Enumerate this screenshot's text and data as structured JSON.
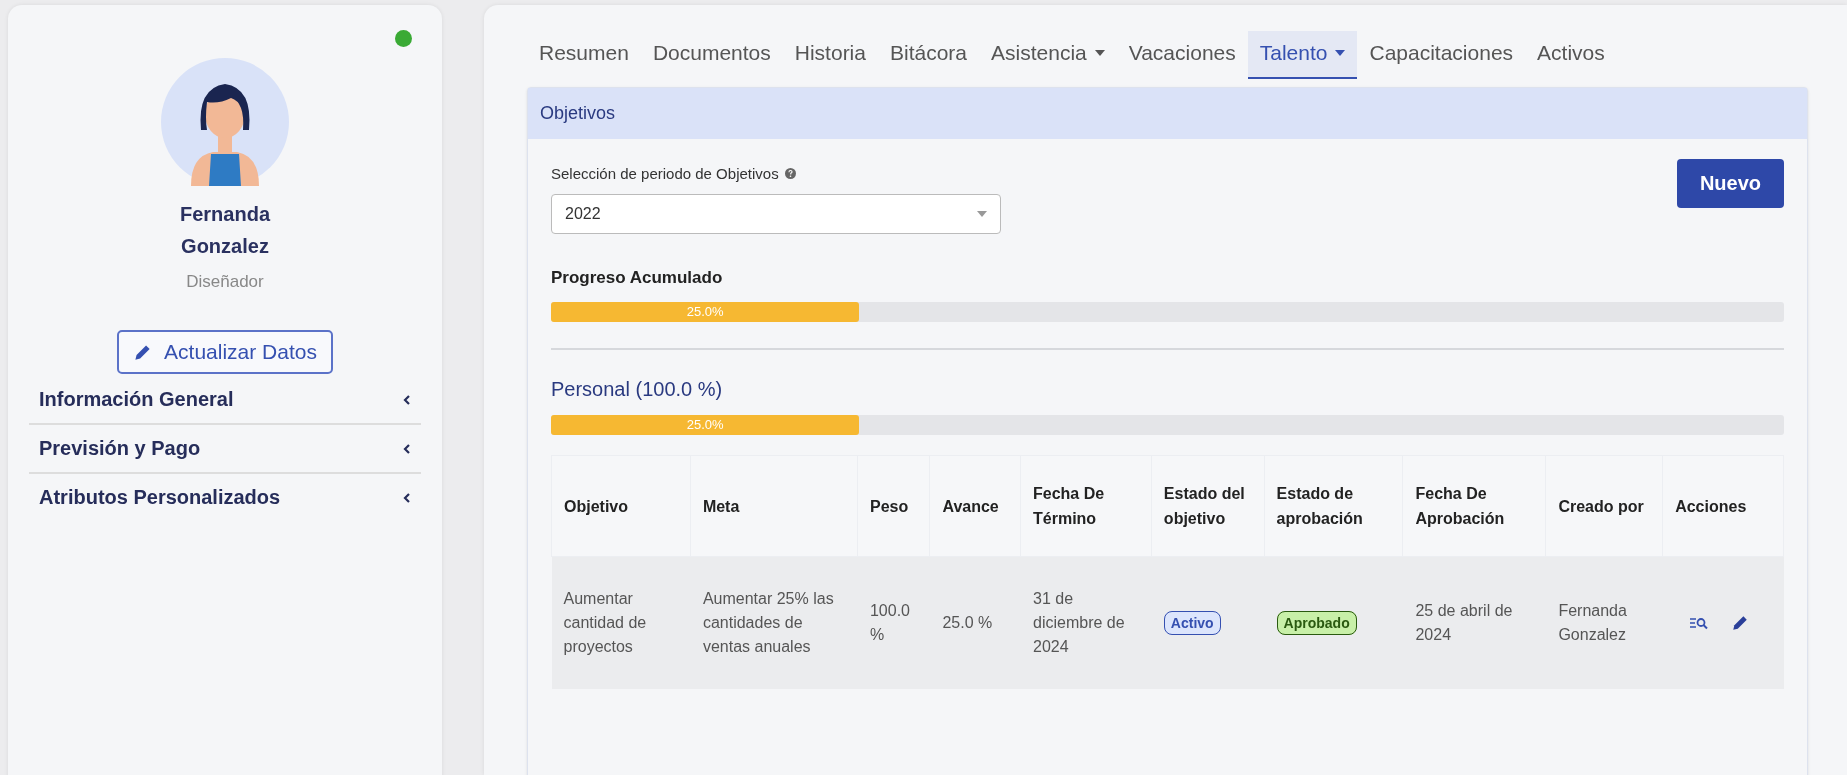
{
  "profile": {
    "name": "Fernanda Gonzalez",
    "role": "Diseñador",
    "update_button": "Actualizar Datos"
  },
  "sections": [
    {
      "label": "Información General",
      "expanded": false
    },
    {
      "label": "Previsión y Pago",
      "expanded": false
    },
    {
      "label": "Atributos Personalizados",
      "expanded": false
    }
  ],
  "tabs": [
    {
      "label": "Resumen",
      "selected": false,
      "dropdown": false
    },
    {
      "label": "Documentos",
      "selected": false,
      "dropdown": false
    },
    {
      "label": "Historia",
      "selected": false,
      "dropdown": false
    },
    {
      "label": "Bitácora",
      "selected": false,
      "dropdown": false
    },
    {
      "label": "Asistencia",
      "selected": false,
      "dropdown": true
    },
    {
      "label": "Vacaciones",
      "selected": false,
      "dropdown": false
    },
    {
      "label": "Talento",
      "selected": true,
      "dropdown": true
    },
    {
      "label": "Capacitaciones",
      "selected": false,
      "dropdown": false
    },
    {
      "label": "Activos",
      "selected": false,
      "dropdown": false
    }
  ],
  "panel": {
    "title": "Objetivos",
    "period_label": "Selección de periodo de Objetivos",
    "period_value": "2022",
    "new_button": "Nuevo",
    "accumulated": {
      "label": "Progreso Acumulado",
      "level": 0.25,
      "reading": "25.0%"
    },
    "group": {
      "label": "Personal (100.0 %)",
      "level": 0.25,
      "reading": "25.0%"
    },
    "table": {
      "columns": [
        "Objetivo",
        "Meta",
        "Peso",
        "Avance",
        "Fecha De Término",
        "Estado del objetivo",
        "Estado de aprobación",
        "Fecha De Aprobación",
        "Creado por",
        "Acciones"
      ],
      "rows": [
        {
          "objetivo": "Aumentar cantidad de proyectos",
          "meta": "Aumentar 25% las cantidades de ventas anuales",
          "peso": "100.0 %",
          "avance": "25.0 %",
          "fecha_termino": "31 de diciembre de 2024",
          "estado": {
            "label": "Activo",
            "kind": "info"
          },
          "aprobacion": {
            "label": "Aprobado",
            "kind": "success"
          },
          "fecha_aprobacion": "25 de abril de 2024",
          "creado_por": "Fernanda Gonzalez"
        }
      ]
    }
  }
}
